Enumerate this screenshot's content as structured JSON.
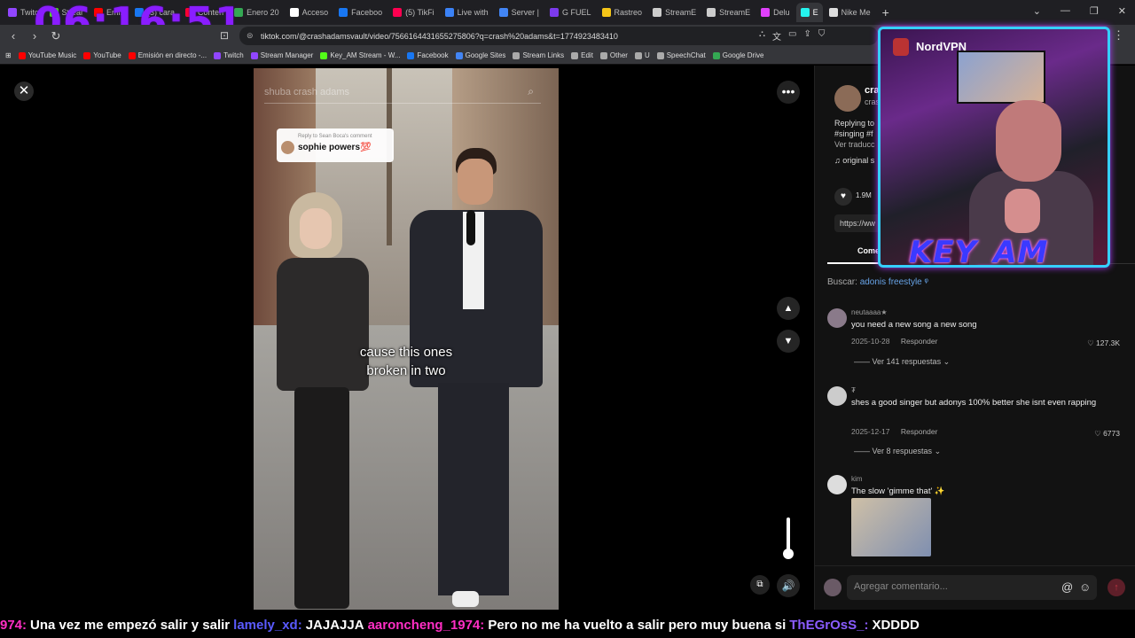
{
  "clock": "06:16:51",
  "browser": {
    "tabs": [
      {
        "label": "Twitc",
        "color": "#9146ff"
      },
      {
        "label": "Strear",
        "color": "#53fc18"
      },
      {
        "label": "Emis",
        "color": "#ff0000"
      },
      {
        "label": "(3) cara",
        "color": "#1877f2"
      },
      {
        "label": "Conten",
        "color": "#ff0033"
      },
      {
        "label": "Enero 20",
        "color": "#34a853"
      },
      {
        "label": "Acceso",
        "color": "#ffffff"
      },
      {
        "label": "Faceboo",
        "color": "#1877f2"
      },
      {
        "label": "(5) TikFi",
        "color": "#ff0050"
      },
      {
        "label": "Live with",
        "color": "#3b82f6"
      },
      {
        "label": "Server |",
        "color": "#4285f4"
      },
      {
        "label": "G FUEL",
        "color": "#7c3aed"
      },
      {
        "label": "Rastreo",
        "color": "#f5c518"
      },
      {
        "label": "StreamE",
        "color": "#cccccc"
      },
      {
        "label": "StreamE",
        "color": "#cccccc"
      },
      {
        "label": "Delu",
        "color": "#e040fb"
      },
      {
        "label": "E",
        "color": "#25f4ee"
      },
      {
        "label": "Nike Me",
        "color": "#dddddd"
      }
    ],
    "new_tab": "+",
    "window_controls": [
      "⌄",
      "—",
      "❐",
      "✕"
    ],
    "url": "tiktok.com/@crashadamsvault/video/7566164431655275806?q=crash%20adams&t=1774923483410",
    "bookmarks": [
      {
        "label": "YouTube Music",
        "color": "#ff0000"
      },
      {
        "label": "YouTube",
        "color": "#ff0000"
      },
      {
        "label": "Emisión en directo -...",
        "color": "#ff0000"
      },
      {
        "label": "Twitch",
        "color": "#9146ff"
      },
      {
        "label": "Stream Manager",
        "color": "#9146ff"
      },
      {
        "label": "Key_AM Stream - W...",
        "color": "#53fc18"
      },
      {
        "label": "Facebook",
        "color": "#1877f2"
      },
      {
        "label": "Google Sites",
        "color": "#4285f4"
      },
      {
        "label": "Stream Links",
        "color": "#aaaaaa"
      },
      {
        "label": "Edit",
        "color": "#aaaaaa"
      },
      {
        "label": "Other",
        "color": "#aaaaaa"
      },
      {
        "label": "U",
        "color": "#aaaaaa"
      },
      {
        "label": "SpeechChat",
        "color": "#aaaaaa"
      },
      {
        "label": "Google Drive",
        "color": "#34a853"
      }
    ]
  },
  "video": {
    "search_placeholder": "shuba crash adams",
    "reply_top": "Reply to Sean Boca's comment",
    "reply_name": "sophie powers💯",
    "caption_line1": "cause this ones",
    "caption_line2": "broken in two"
  },
  "panel": {
    "creator_name": "cra",
    "creator_sub": "cras",
    "desc1": "Replying to",
    "desc2": "#singing #f",
    "desc3": "Ver traducc",
    "music": "♫ original s",
    "likes": "1.9M",
    "link": "https://ww",
    "tab_comments": "Come",
    "search_label": "Buscar:",
    "search_term": "adonis freestyle",
    "comments": [
      {
        "user": "neutaaaa★",
        "text": "you need a new song a new song",
        "date": "2025-10-28",
        "reply": "Responder",
        "likes": "127.3K",
        "replies": "Ver 141 respuestas"
      },
      {
        "user": "₮",
        "text": "shes a good singer but adonys 100% better she isnt even rapping",
        "date": "2025-12-17",
        "reply": "Responder",
        "likes": "6773",
        "replies": "Ver 8 respuestas"
      },
      {
        "user": "kim",
        "text": "The slow 'gimme that' ✨"
      }
    ],
    "comment_placeholder": "Agregar comentario..."
  },
  "webcam": {
    "vpn_label": "NordVPN",
    "streamer_name": "KEY_AM"
  },
  "chat": [
    {
      "user": "974:",
      "user_color": "#ff2ec4",
      "text": "Una vez me empezó salir y salir"
    },
    {
      "user": "lamely_xd:",
      "user_color": "#5a5aff",
      "text": "JAJAJJA"
    },
    {
      "user": "aaroncheng_1974:",
      "user_color": "#ff2ec4",
      "text": "Pero no me ha vuelto a salir pero muy buena si"
    },
    {
      "user": "ThEGrOsS_:",
      "user_color": "#8a5cff",
      "text": "XDDDD"
    }
  ]
}
